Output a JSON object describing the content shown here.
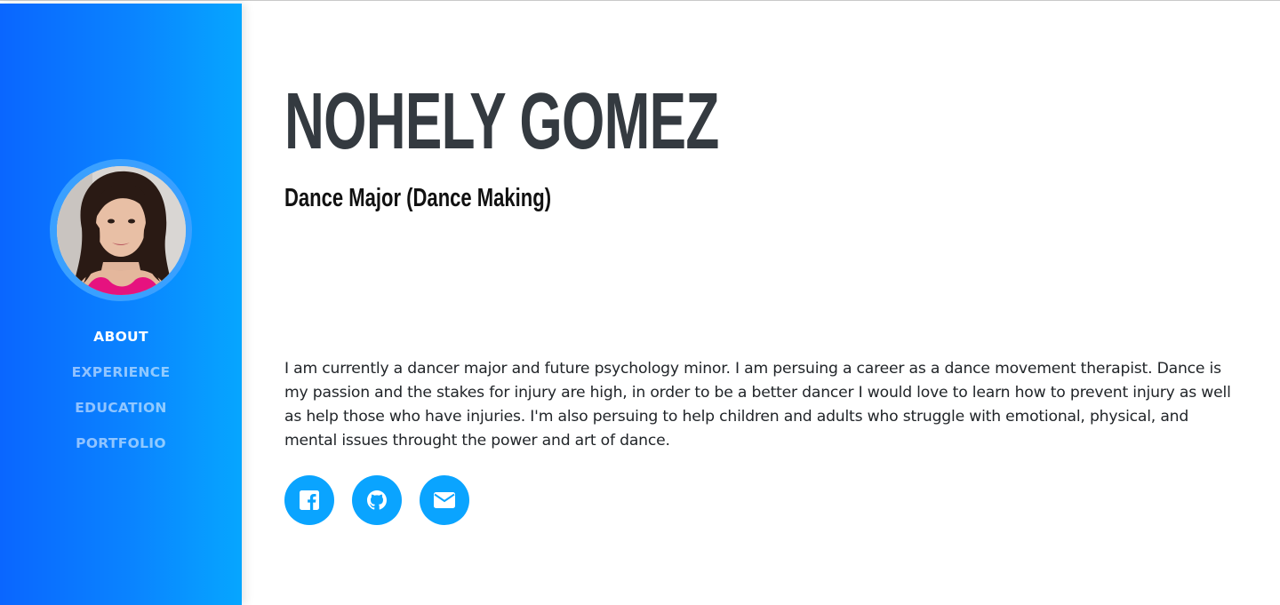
{
  "profile": {
    "name": "NOHELY GOMEZ",
    "subtitle": "Dance Major (Dance Making)",
    "bio": "I am currently a dancer major and future psychology minor. I am persuing a career as a dance movement therapist. Dance is my passion and the stakes for injury are high, in order to be a better dancer I would love to learn how to prevent injury as well as help those who have injuries. I'm also persuing to help children and adults who struggle with emotional, physical, and mental issues throught the power and art of dance.",
    "avatar_icon": "profile-photo"
  },
  "nav": {
    "items": [
      {
        "label": "ABOUT",
        "active": true
      },
      {
        "label": "EXPERIENCE",
        "active": false
      },
      {
        "label": "EDUCATION",
        "active": false
      },
      {
        "label": "PORTFOLIO",
        "active": false
      }
    ]
  },
  "socials": [
    {
      "icon": "facebook-icon"
    },
    {
      "icon": "github-icon"
    },
    {
      "icon": "envelope-icon"
    }
  ],
  "colors": {
    "sidebar_start": "#0a66ff",
    "sidebar_end": "#06a6ff",
    "accent": "#0aa4ff",
    "heading": "#343a40",
    "nav_inactive": "rgba(255,255,255,0.55)"
  }
}
